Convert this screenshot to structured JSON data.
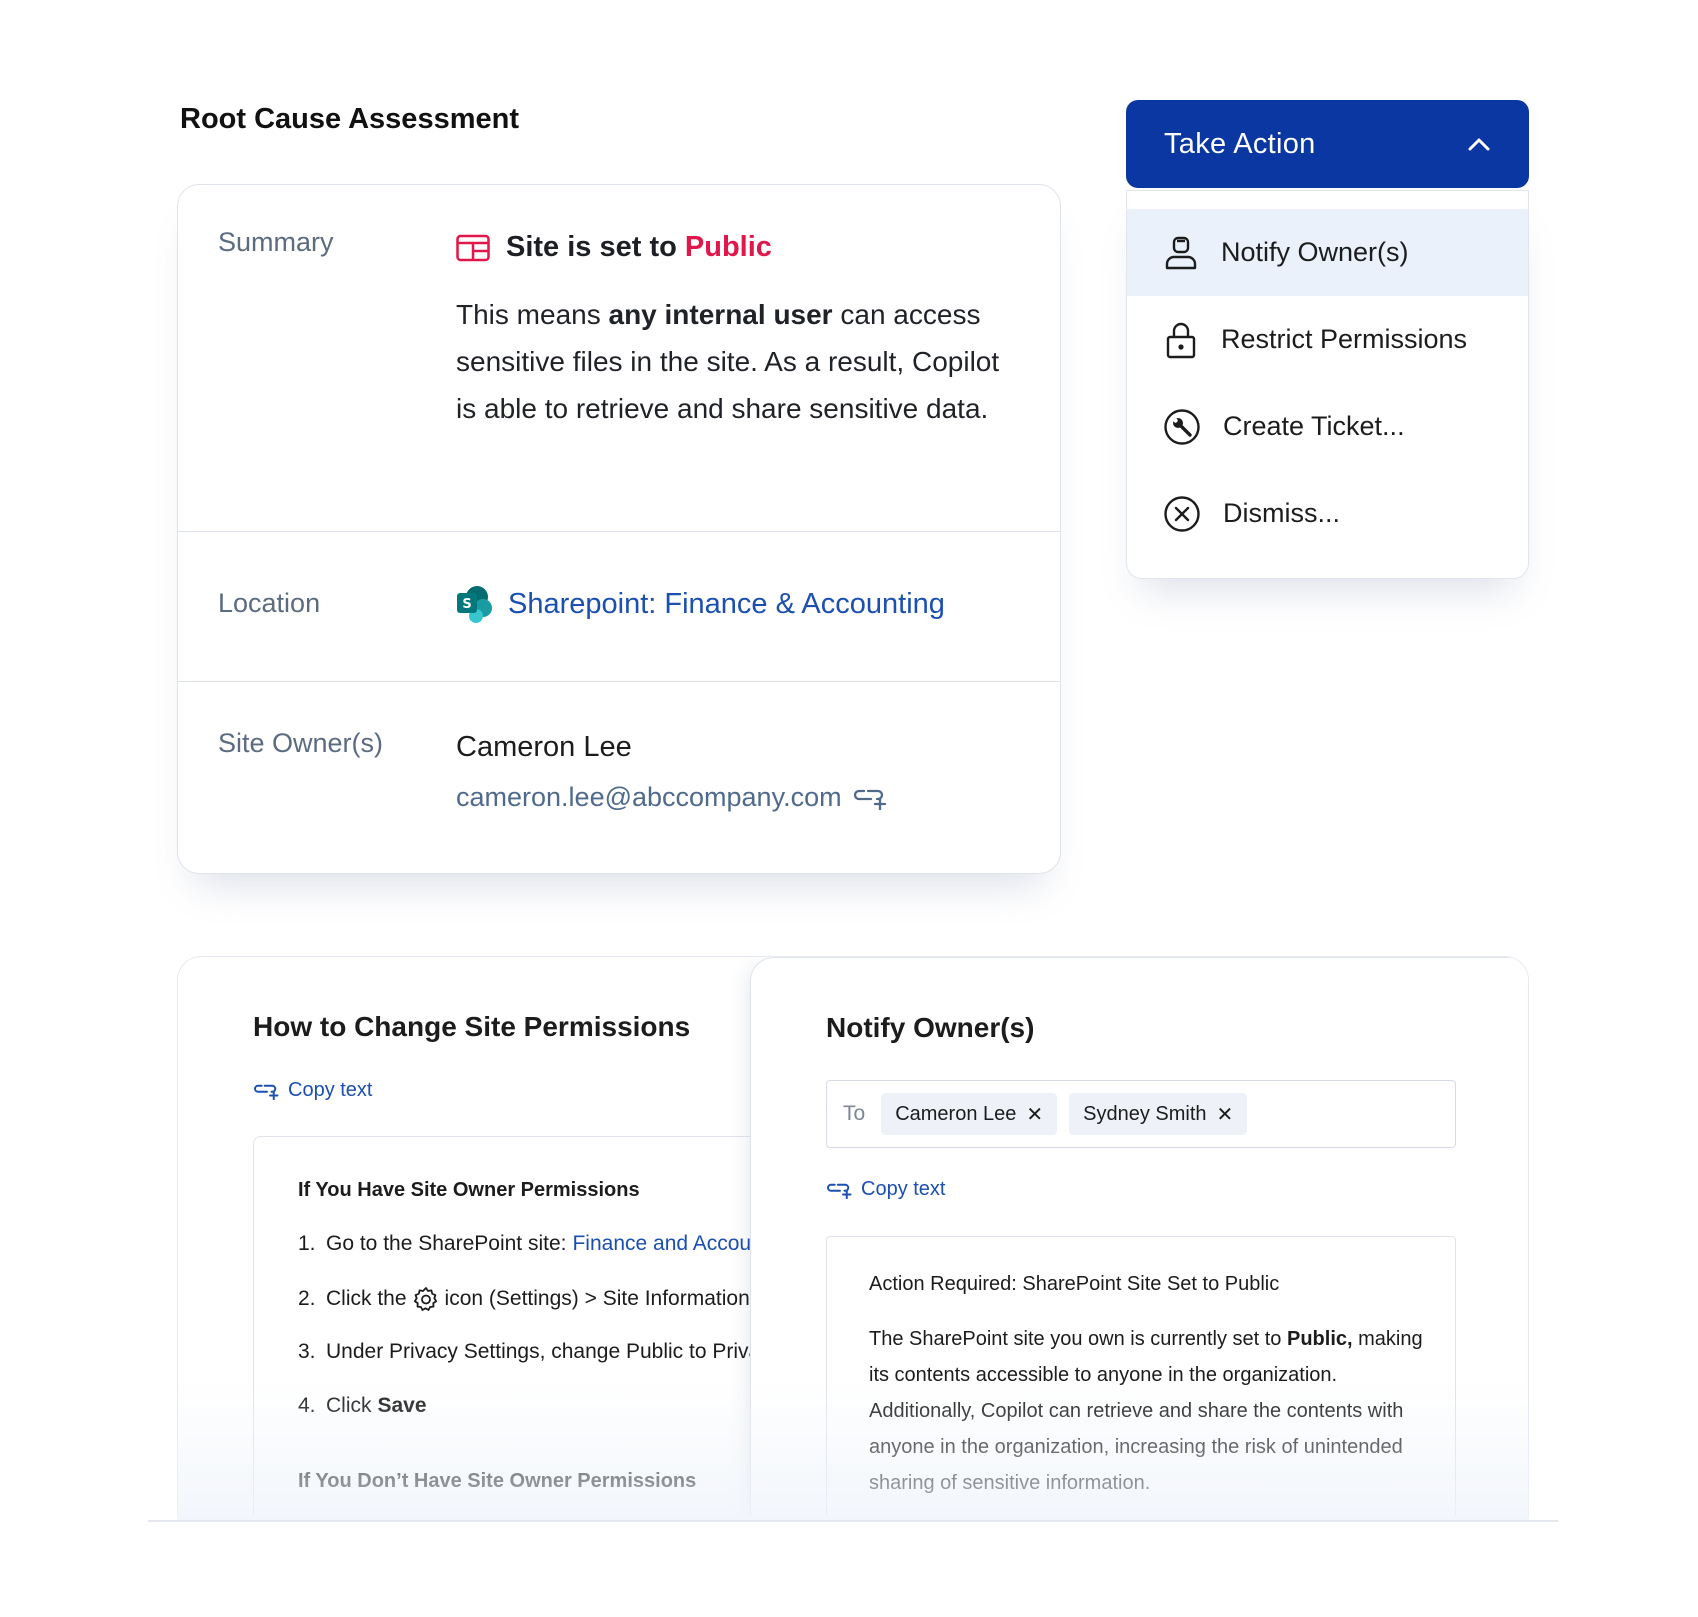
{
  "page_title": "Root Cause Assessment",
  "summary": {
    "label": "Summary",
    "headline_prefix": "Site is set to ",
    "headline_status": "Public",
    "body_part1": "This means ",
    "body_bold": "any internal user",
    "body_part2": " can access sensitive files in the site. As a result, Copilot is able to retrieve and share sensitive data."
  },
  "location": {
    "label": "Location",
    "value": "Sharepoint: Finance & Accounting"
  },
  "site_owners": {
    "label": "Site Owner(s)",
    "name": "Cameron Lee",
    "email": "cameron.lee@abccompany.com"
  },
  "take_action": {
    "button_label": "Take Action",
    "items": [
      {
        "label": "Notify Owner(s)",
        "icon": "person-icon"
      },
      {
        "label": "Restrict Permissions",
        "icon": "lock-icon"
      },
      {
        "label": "Create Ticket...",
        "icon": "wrench-icon"
      },
      {
        "label": "Dismiss...",
        "icon": "close-circle-icon"
      }
    ]
  },
  "instructions": {
    "title": "How to Change Site Permissions",
    "copy_label": "Copy text",
    "heading1": "If You Have Site Owner Permissions",
    "steps": [
      {
        "num": "1.",
        "text": "Go to the SharePoint site:",
        "link": "Finance and Accounting"
      },
      {
        "num": "2.",
        "pre": "Click the",
        "post": "icon (Settings) > Site Information"
      },
      {
        "num": "3.",
        "text": "Under Privacy Settings, change Public to Private"
      },
      {
        "num": "4.",
        "text": "Click",
        "bold": "Save"
      }
    ],
    "heading2": "If You Don’t Have Site Owner Permissions"
  },
  "notify": {
    "title": "Notify Owner(s)",
    "to_label": "To",
    "recipients": [
      "Cameron Lee",
      "Sydney Smith"
    ],
    "copy_label": "Copy text",
    "subject": "Action Required: SharePoint Site Set to Public",
    "body_part1": "The SharePoint site you own is currently set to ",
    "body_bold": "Public,",
    "body_part2": " making its contents accessible to anyone in the organization. Additionally, Copilot can retrieve and share the contents with anyone in the organization, increasing the risk of unintended sharing of sensitive information."
  },
  "colors": {
    "primary": "#0a37a1",
    "link": "#1b4fb0",
    "public_status": "#e0174a",
    "menu_highlight": "#eaf1fb"
  }
}
